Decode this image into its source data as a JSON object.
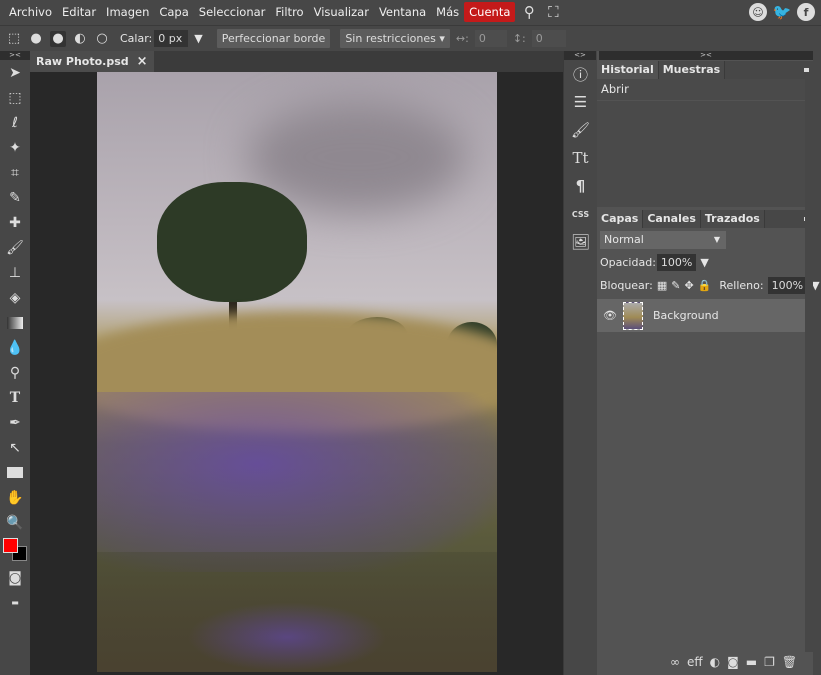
{
  "menubar": {
    "items": [
      "Archivo",
      "Editar",
      "Imagen",
      "Capa",
      "Seleccionar",
      "Filtro",
      "Visualizar",
      "Ventana",
      "Más"
    ],
    "account": "Cuenta",
    "account_color": "#c41a1a"
  },
  "options": {
    "feather_label": "Calar:",
    "feather_value": "0 px",
    "refine_edge": "Perfeccionar borde",
    "style": "Sin restricciones",
    "width_label": "↔:",
    "width_value": "0",
    "height_label": "↕:",
    "height_value": "0"
  },
  "document": {
    "tab_title": "Raw Photo.psd",
    "close": "×"
  },
  "colors": {
    "foreground": "#ff0000",
    "background": "#000000"
  },
  "history_panel": {
    "tabs": [
      "Historial",
      "Muestras"
    ],
    "items": [
      "Abrir"
    ]
  },
  "layers_panel": {
    "tabs": [
      "Capas",
      "Canales",
      "Trazados"
    ],
    "blend_mode": "Normal",
    "opacity_label": "Opacidad:",
    "opacity_value": "100%",
    "lock_label": "Bloquear:",
    "fill_label": "Relleno:",
    "fill_value": "100%",
    "layers": [
      {
        "name": "Background",
        "visible": true
      }
    ],
    "eff_label": "eff"
  },
  "collapse_labels": {
    "left": "><",
    "middle": "<>",
    "right": "><"
  }
}
